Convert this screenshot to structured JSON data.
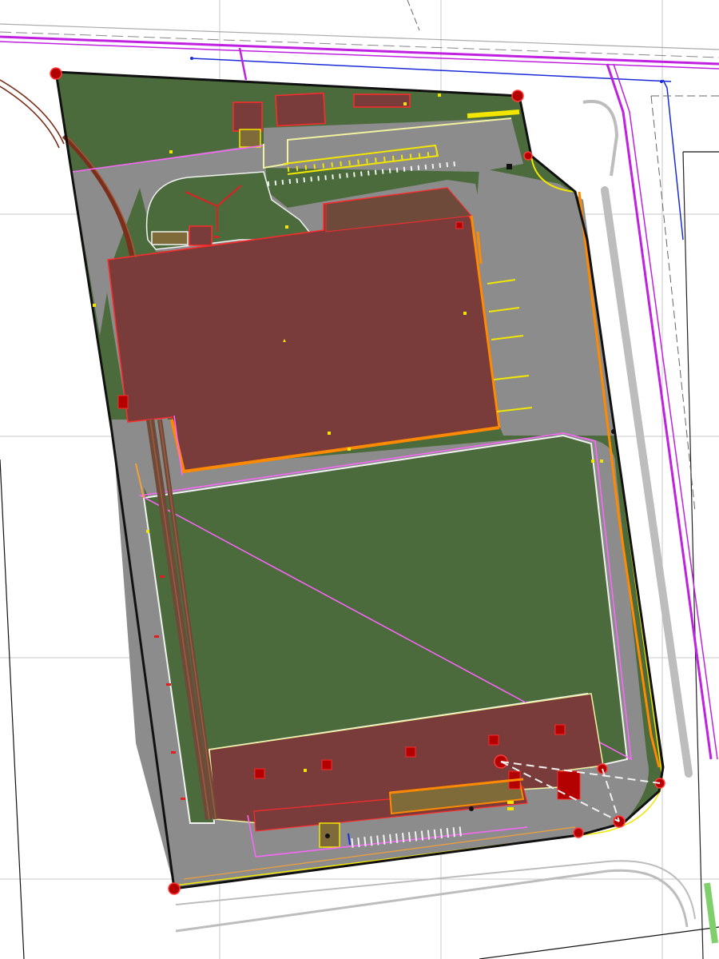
{
  "map": {
    "kind": "site-plan",
    "colors": {
      "background": "#ffffff",
      "grid": "#c8c8c8",
      "lawn": "#4b6b3c",
      "pavement": "#8c8c8c",
      "building": "#7a3b3b",
      "building_outline": "#ff2b2b",
      "boundary": "#111111",
      "utility_magenta": "#c020e0",
      "utility_blue": "#1a2bd8",
      "curb_white": "#f2f2f2",
      "parking_yellow": "#f2e600",
      "orange_line": "#ff8a00",
      "pink_line": "#ff66ff",
      "railway": "#7a2f1c",
      "control_point": "#b30000",
      "road_edge": "#bdbdbd"
    },
    "features": {
      "site_boundary": "plot-boundary",
      "main_building": "warehouse-north",
      "south_building": "warehouse-south",
      "lawn_area": "green-field",
      "rail_spur": "rail-siding",
      "parking": "parking-stalls",
      "utilities": "utility-lines",
      "survey_points": "control-points"
    }
  }
}
